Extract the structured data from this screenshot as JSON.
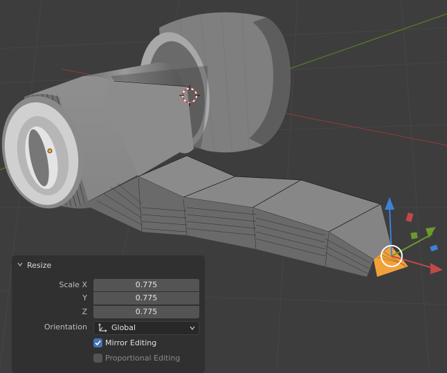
{
  "panel": {
    "title": "Resize",
    "scale_x_label": "Scale X",
    "scale_y_label": "Y",
    "scale_z_label": "Z",
    "scale_x": "0.775",
    "scale_y": "0.775",
    "scale_z": "0.775",
    "orientation_label": "Orientation",
    "orientation_value": "Global",
    "mirror_label": "Mirror Editing",
    "mirror_checked": true,
    "proportional_label": "Proportional Editing",
    "proportional_checked": false
  },
  "viewport": {
    "icons": [
      "3d-cursor-icon",
      "origin-dot-icon",
      "transform-gizmo-icon"
    ],
    "axis_colors": {
      "x": "#c44747",
      "y": "#6a9a2c",
      "z": "#3b82d8"
    },
    "selection_color": "#f2a13a"
  }
}
